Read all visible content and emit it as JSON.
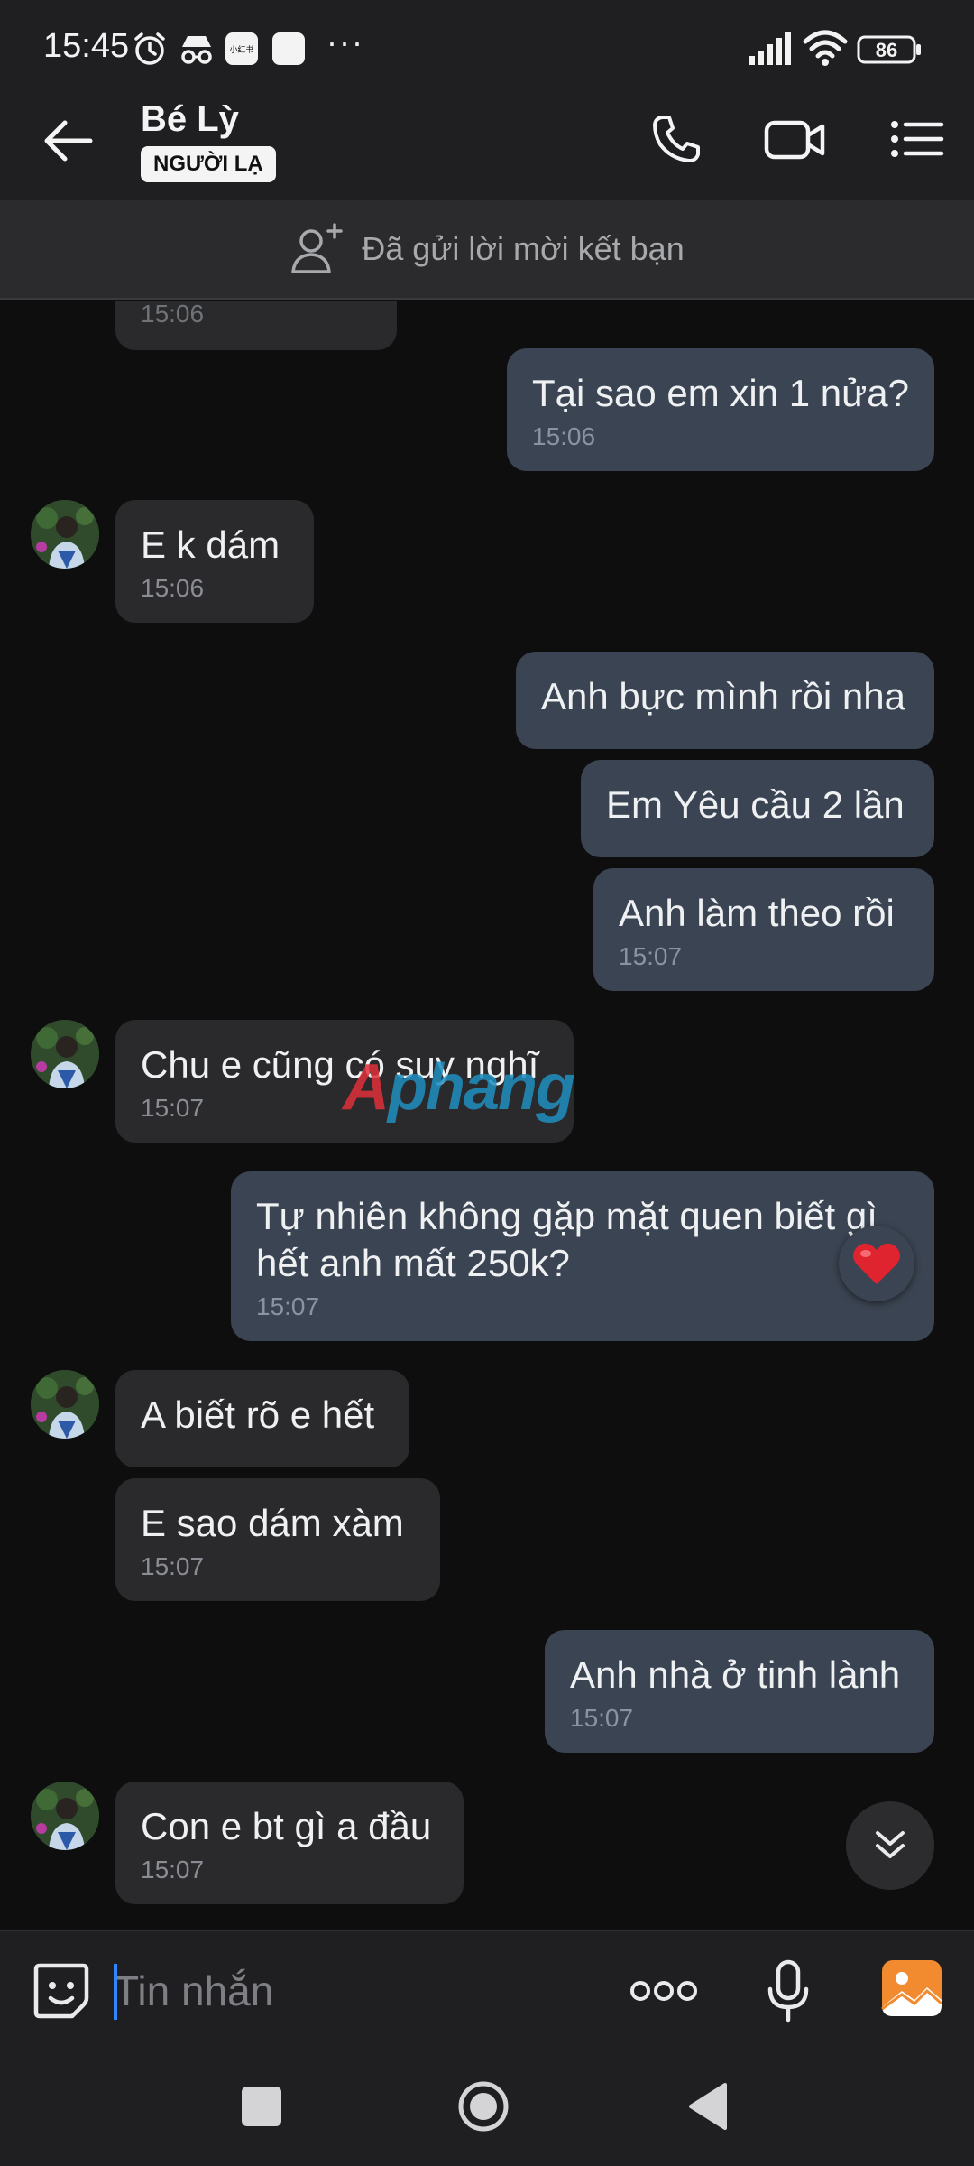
{
  "status_bar": {
    "time": "15:45",
    "app_badge_text": "小红书",
    "overflow": "···",
    "battery": "86"
  },
  "header": {
    "contact_name": "Bé Lỳ",
    "badge": "NGƯỜI LẠ"
  },
  "friend_banner": {
    "text": "Đã gửi lời mời kết bạn"
  },
  "messages": [
    {
      "dir": "out",
      "text": "Tại sao em xin 1 nửa?",
      "time": "15:06"
    },
    {
      "dir": "in",
      "text": "E k dám",
      "time": "15:06"
    },
    {
      "dir": "out",
      "text": "Anh bực mình rồi nha",
      "time": ""
    },
    {
      "dir": "out",
      "text": "Em Yêu cầu 2 lần",
      "time": ""
    },
    {
      "dir": "out",
      "text": "Anh làm theo rồi",
      "time": "15:07"
    },
    {
      "dir": "in",
      "text": "Chu e cũng có suy nghĩ",
      "time": "15:07"
    },
    {
      "dir": "out",
      "text": "Tự nhiên không gặp mặt quen biết gì hết anh mất 250k?",
      "time": "15:07",
      "reaction": "heart"
    },
    {
      "dir": "in",
      "text": "A biết rõ e hết",
      "time": ""
    },
    {
      "dir": "in",
      "text": "E sao dám xàm",
      "time": "15:07"
    },
    {
      "dir": "out",
      "text": "Anh nhà ở tinh lành",
      "time": "15:07"
    },
    {
      "dir": "in",
      "text": "Con e bt gì a đầu",
      "time": "15:07"
    }
  ],
  "partial_time": "15:06",
  "watermark": {
    "part1": "A",
    "part2": "phang"
  },
  "input": {
    "placeholder": "Tin nhắn"
  },
  "colors": {
    "bubble_in": "#2a2a2c",
    "bubble_out": "#3b4452",
    "accent": "#2f86ff",
    "image_button": "#f28a2f"
  }
}
